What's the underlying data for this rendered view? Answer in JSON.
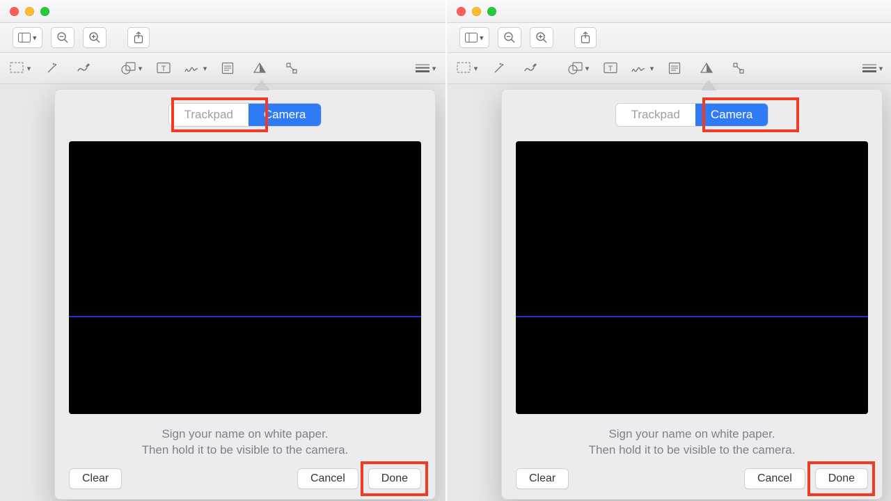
{
  "window": {
    "traffic": [
      "close",
      "minimize",
      "zoom"
    ]
  },
  "segmented": {
    "trackpad_label": "Trackpad",
    "camera_label": "Camera",
    "active": "camera"
  },
  "camera": {
    "guideline_color": "#2a2fd0"
  },
  "hint": {
    "line1": "Sign your name on white paper.",
    "line2": "Then hold it to be visible to the camera."
  },
  "buttons": {
    "clear": "Clear",
    "cancel": "Cancel",
    "done": "Done"
  },
  "toolbar": {
    "sidebar": "sidebar-toggle",
    "zoom_out": "zoom-out",
    "zoom_in": "zoom-in",
    "share": "share",
    "markup_items": [
      "selection",
      "magic-wand",
      "draw",
      "shapes",
      "text",
      "signature",
      "note",
      "adjust-color",
      "crop",
      "lines"
    ]
  },
  "left_panel_highlight": "trackpad",
  "right_panel_highlight": "camera"
}
